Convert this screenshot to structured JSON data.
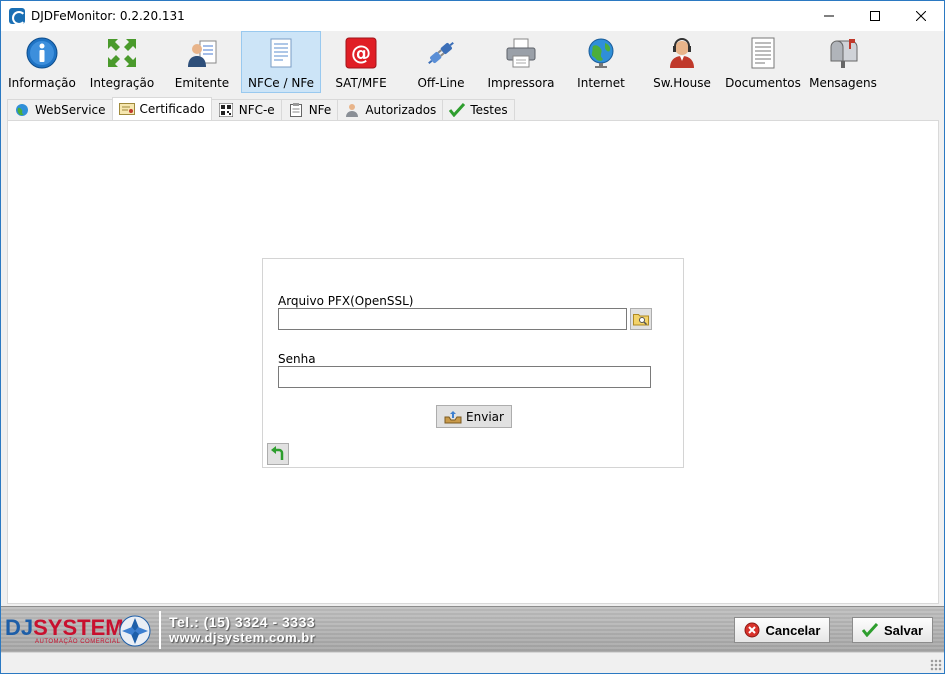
{
  "window": {
    "title": "DJDFeMonitor: 0.2.20.131"
  },
  "toolbar": {
    "items": [
      {
        "label": "Informação",
        "icon": "info-icon"
      },
      {
        "label": "Integração",
        "icon": "integration-icon"
      },
      {
        "label": "Emitente",
        "icon": "issuer-icon"
      },
      {
        "label": "NFCe / NFe",
        "icon": "invoice-icon",
        "active": true
      },
      {
        "label": "SAT/MFE",
        "icon": "at-icon"
      },
      {
        "label": "Off-Line",
        "icon": "plug-icon"
      },
      {
        "label": "Impressora",
        "icon": "printer-icon"
      },
      {
        "label": "Internet",
        "icon": "globe-icon"
      },
      {
        "label": "Sw.House",
        "icon": "support-icon"
      },
      {
        "label": "Documentos",
        "icon": "documents-icon"
      },
      {
        "label": "Mensagens",
        "icon": "mailbox-icon"
      }
    ]
  },
  "tabs": [
    {
      "label": "WebService",
      "icon": "globe-icon"
    },
    {
      "label": "Certificado",
      "icon": "certificate-icon",
      "active": true
    },
    {
      "label": "NFC-e",
      "icon": "qrcode-icon"
    },
    {
      "label": "NFe",
      "icon": "clipboard-icon"
    },
    {
      "label": "Autorizados",
      "icon": "user-icon"
    },
    {
      "label": "Testes",
      "icon": "check-icon"
    }
  ],
  "cert": {
    "pfx_label": "Arquivo PFX(OpenSSL)",
    "pfx_value": "",
    "password_label": "Senha",
    "password_value": "",
    "send_label": "Enviar"
  },
  "footer": {
    "brand_dj": "DJ",
    "brand_system": "SYSTEM",
    "brand_sub": "AUTOMAÇÃO COMERCIAL",
    "phone": "Tel.: (15) 3324 - 3333",
    "website": "www.djsystem.com.br",
    "cancel_label": "Cancelar",
    "save_label": "Salvar"
  },
  "colors": {
    "active_tool_bg": "#cce4f7",
    "brand_blue": "#1d5ea8",
    "brand_red": "#c8102e"
  }
}
